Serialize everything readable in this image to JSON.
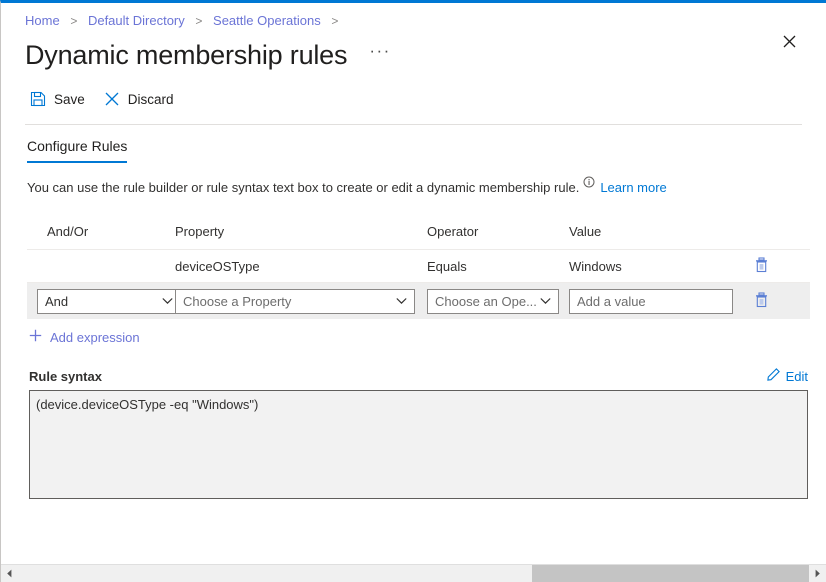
{
  "breadcrumb": {
    "items": [
      "Home",
      "Default Directory",
      "Seattle Operations"
    ],
    "separator": ">"
  },
  "header": {
    "title": "Dynamic membership rules",
    "more_label": "···",
    "close_icon": "close-icon"
  },
  "toolbar": {
    "save_label": "Save",
    "discard_label": "Discard"
  },
  "tabs": [
    {
      "label": "Configure Rules",
      "active": true
    }
  ],
  "description": {
    "text": "You can use the rule builder or rule syntax text box to create or edit a dynamic membership rule.",
    "info_icon": "info-icon",
    "learn_more": "Learn more"
  },
  "rules_table": {
    "columns": [
      "And/Or",
      "Property",
      "Operator",
      "Value"
    ],
    "rows": [
      {
        "type": "static",
        "andor": "",
        "property": "deviceOSType",
        "operator": "Equals",
        "value": "Windows",
        "delete_icon": "trash-icon"
      },
      {
        "type": "editing",
        "andor": "And",
        "property_placeholder": "Choose a Property",
        "operator_placeholder": "Choose an Ope...",
        "value_placeholder": "Add a value",
        "delete_icon": "trash-icon"
      }
    ]
  },
  "add_expression": {
    "label": "Add expression",
    "icon": "plus-icon"
  },
  "rule_syntax": {
    "label": "Rule syntax",
    "edit_label": "Edit",
    "edit_icon": "pencil-icon",
    "value": "(device.deviceOSType -eq \"Windows\")"
  },
  "colors": {
    "accent": "#0078d4",
    "link": "#0078d4",
    "breadcrumb_link": "#6b74d6",
    "row_highlight": "#eeeeee",
    "syntax_bg": "#f2f2f2"
  }
}
